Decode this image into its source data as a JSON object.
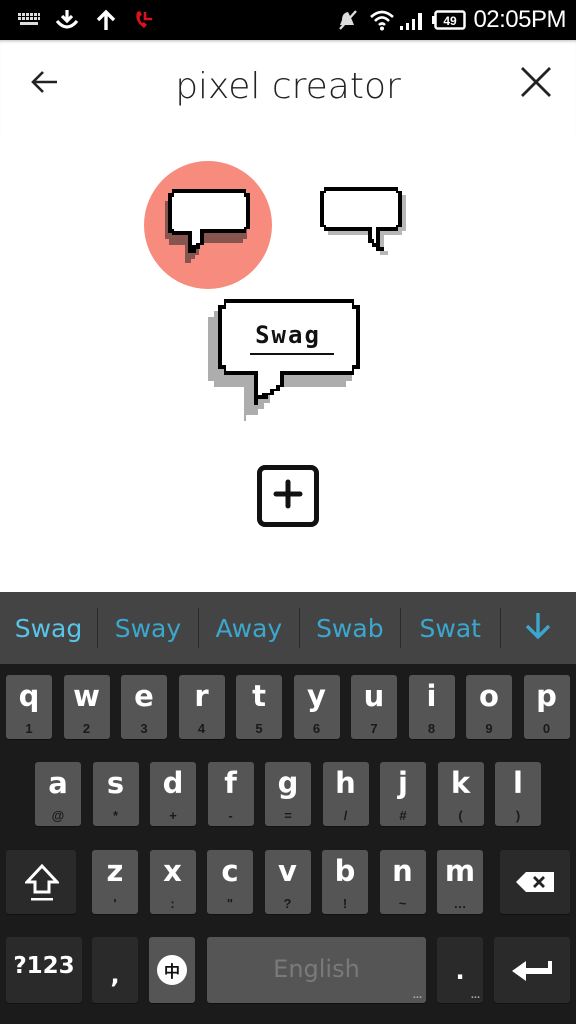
{
  "status_bar": {
    "left_icons": [
      "keyboard-icon",
      "download-icon",
      "upload-icon",
      "missed-call-icon"
    ],
    "right_icons": [
      "muted-bell-icon",
      "wifi-icon",
      "signal-icon",
      "battery-icon"
    ],
    "battery_level": "49",
    "time": "02:05PM",
    "missed_call_color": "#d8141a"
  },
  "appbar": {
    "title": "pixel creator",
    "back_icon": "arrow-left-icon",
    "close_icon": "close-icon"
  },
  "content": {
    "bubble_options": [
      {
        "name": "speech-bubble-shadow-left",
        "selected": true
      },
      {
        "name": "speech-bubble-shadow-right",
        "selected": false
      }
    ],
    "selected_color": "#f78b7d",
    "preview_text": "Swag",
    "add_icon": "plus-icon"
  },
  "keyboard": {
    "suggestions": [
      "Swag",
      "Sway",
      "Away",
      "Swab",
      "Swat"
    ],
    "suggestion_color": "#3ba7cf",
    "expand_icon": "arrow-down-icon",
    "row1": [
      {
        "k": "q",
        "s": "1"
      },
      {
        "k": "w",
        "s": "2"
      },
      {
        "k": "e",
        "s": "3"
      },
      {
        "k": "r",
        "s": "4"
      },
      {
        "k": "t",
        "s": "5"
      },
      {
        "k": "y",
        "s": "6"
      },
      {
        "k": "u",
        "s": "7"
      },
      {
        "k": "i",
        "s": "8"
      },
      {
        "k": "o",
        "s": "9"
      },
      {
        "k": "p",
        "s": "0"
      }
    ],
    "row2": [
      {
        "k": "a",
        "s": "@"
      },
      {
        "k": "s",
        "s": "*"
      },
      {
        "k": "d",
        "s": "+"
      },
      {
        "k": "f",
        "s": "-"
      },
      {
        "k": "g",
        "s": "="
      },
      {
        "k": "h",
        "s": "/"
      },
      {
        "k": "j",
        "s": "#"
      },
      {
        "k": "k",
        "s": "("
      },
      {
        "k": "l",
        "s": ")"
      }
    ],
    "row3": [
      {
        "k": "z",
        "s": "'"
      },
      {
        "k": "x",
        "s": ":"
      },
      {
        "k": "c",
        "s": "\""
      },
      {
        "k": "v",
        "s": "?"
      },
      {
        "k": "b",
        "s": "!"
      },
      {
        "k": "n",
        "s": "~"
      },
      {
        "k": "m",
        "s": "…"
      }
    ],
    "shift_icon": "shift-icon",
    "backspace_icon": "backspace-icon",
    "symbols_label": "?123",
    "comma_label": ",",
    "language_switch_label": "中",
    "space_label": "English",
    "space_more": "...",
    "period_label": ".",
    "period_more": "...",
    "enter_icon": "enter-icon"
  }
}
